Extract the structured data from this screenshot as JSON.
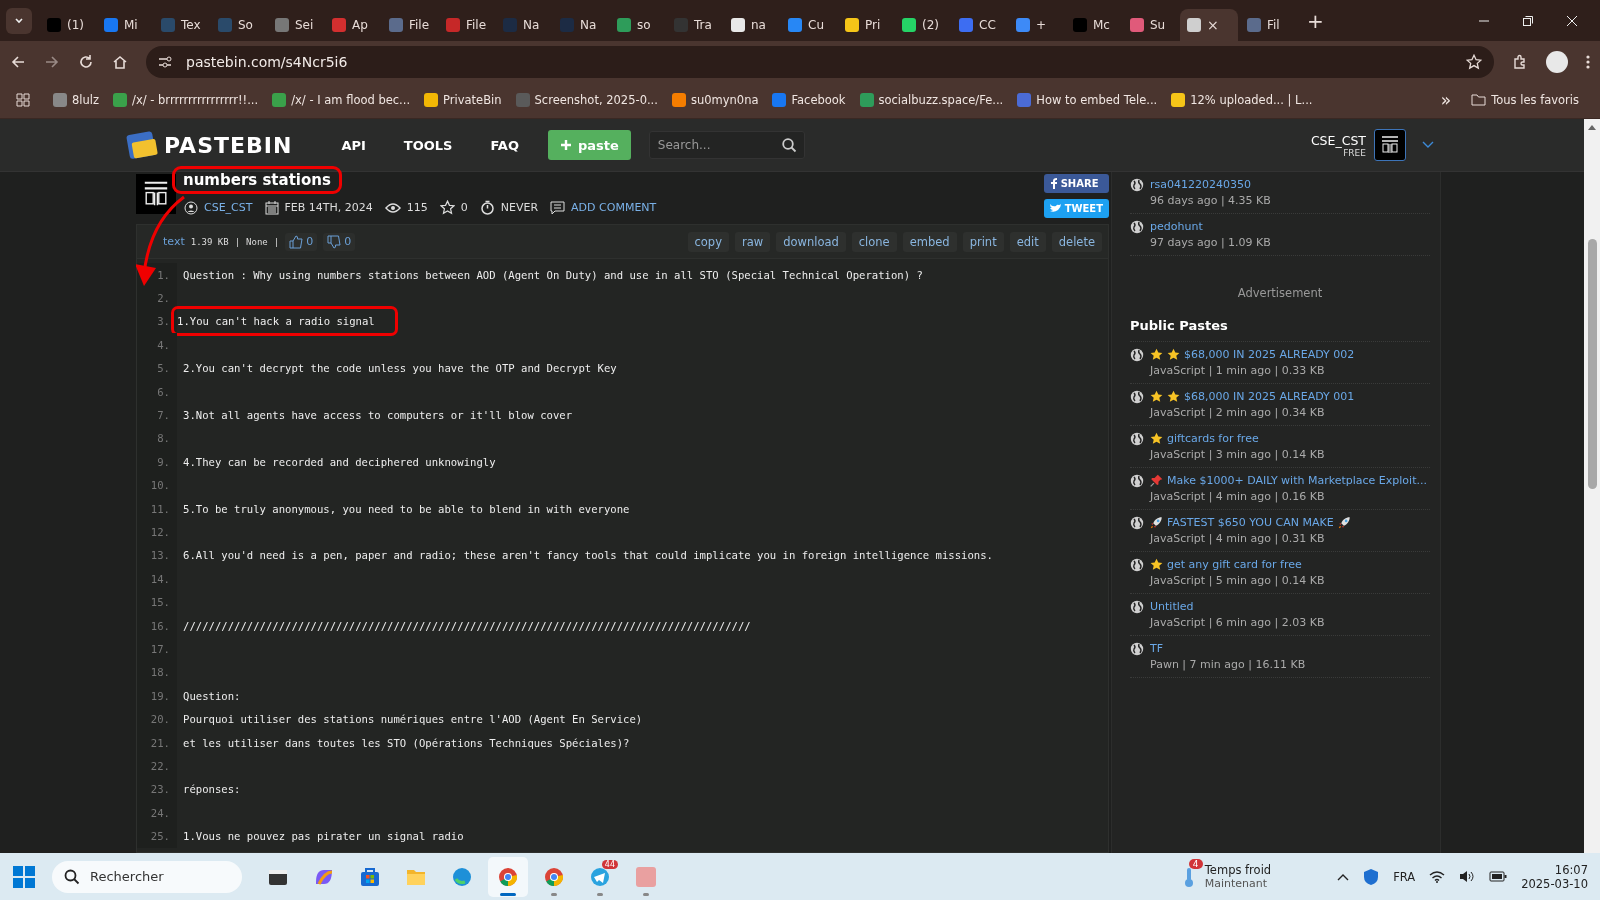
{
  "browser": {
    "tabs": [
      {
        "label": "(1)",
        "color": "#000000",
        "selected": false
      },
      {
        "label": "Mi",
        "color": "#1877f2",
        "selected": false
      },
      {
        "label": "Tex",
        "color": "#2a4a6a",
        "selected": false
      },
      {
        "label": "So",
        "color": "#2a4a6a",
        "selected": false
      },
      {
        "label": "Sei",
        "color": "#777777",
        "selected": false
      },
      {
        "label": "Ap",
        "color": "#d32f2f",
        "selected": false
      },
      {
        "label": "File",
        "color": "#5b6b8c",
        "selected": false
      },
      {
        "label": "File",
        "color": "#c62828",
        "selected": false
      },
      {
        "label": "Na",
        "color": "#1c2b44",
        "selected": false
      },
      {
        "label": "Na",
        "color": "#1c2b44",
        "selected": false
      },
      {
        "label": "so",
        "color": "#2e9c5a",
        "selected": false
      },
      {
        "label": "Tra",
        "color": "#333333",
        "selected": false
      },
      {
        "label": "na",
        "color": "#e8e8e8",
        "selected": false
      },
      {
        "label": "Cu",
        "color": "#2787f5",
        "selected": false
      },
      {
        "label": "Pri",
        "color": "#f5c518",
        "selected": false
      },
      {
        "label": "(2)",
        "color": "#25d366",
        "selected": false
      },
      {
        "label": "CC",
        "color": "#3d6df2",
        "selected": false
      },
      {
        "label": "+ ",
        "color": "#3d8af7",
        "selected": false
      },
      {
        "label": "Mc",
        "color": "#000000",
        "selected": false
      },
      {
        "label": "Su",
        "color": "#e05a7a",
        "selected": false
      },
      {
        "color": "#cfcfcf",
        "selected": true,
        "close": "×"
      },
      {
        "label": "Fil",
        "color": "#5b6b8c",
        "selected": false
      }
    ],
    "new_tab": "+",
    "address": "pastebin.com/s4Ncr5i6",
    "bookmarks": [
      {
        "label": "8lulz",
        "color": "#888888"
      },
      {
        "label": "/x/ - brrrrrrrrrrrrrrrr!!...",
        "color": "#3aa14a"
      },
      {
        "label": "/x/ - I am flood bec...",
        "color": "#3aa14a"
      },
      {
        "label": "PrivateBin",
        "color": "#f2b705"
      },
      {
        "label": "Screenshot, 2025-0...",
        "color": "#5a5a5a"
      },
      {
        "label": "su0myn0na",
        "color": "#f57d00"
      },
      {
        "label": "Facebook",
        "color": "#1877f2"
      },
      {
        "label": "socialbuzz.space/Fe...",
        "color": "#2e9c5a"
      },
      {
        "label": "How to embed Tele...",
        "color": "#4b6bd6"
      },
      {
        "label": "12% uploaded... | L...",
        "color": "#f5c518"
      }
    ],
    "more_bookmarks": "»",
    "all_bookmarks": "Tous les favoris"
  },
  "header": {
    "logo": "PASTEBIN",
    "nav": [
      "API",
      "TOOLS",
      "FAQ"
    ],
    "new_paste": "paste",
    "search": {
      "placeholder": "Search..."
    },
    "user": "CSE_CST",
    "plan": "FREE"
  },
  "paste": {
    "title": "numbers stations",
    "title_highlighted": true,
    "author": "CSE_CST",
    "date": "FEB 14TH, 2024",
    "views": "115",
    "stars": "0",
    "expires": "NEVER",
    "add_comment": "ADD COMMENT",
    "share": "SHARE",
    "tweet": "TWEET",
    "syntax": "text",
    "size": "1.39 KB",
    "sep1": "|",
    "category": "None",
    "sep2": "|",
    "likes": "0",
    "dislikes": "0",
    "actions": [
      "copy",
      "raw",
      "download",
      "clone",
      "embed",
      "print",
      "edit",
      "delete"
    ],
    "annotation_arrow": true,
    "lines": [
      {
        "number": "1.",
        "text": "Question : Why using numbers stations between AOD (Agent On Duty) and use in all STO (Special Technical Operation) ?"
      },
      {
        "number": "2."
      },
      {
        "number": "3.",
        "text": "1.You can't hack a radio signal",
        "highlighted": true
      },
      {
        "number": "4."
      },
      {
        "number": "5.",
        "text": "2.You can't decrypt the code unless you have the OTP and Decrypt Key"
      },
      {
        "number": "6."
      },
      {
        "number": "7.",
        "text": "3.Not all agents have access to computers or it'll blow cover"
      },
      {
        "number": "8."
      },
      {
        "number": "9.",
        "text": "4.They can be recorded and deciphered unknowingly"
      },
      {
        "number": "10."
      },
      {
        "number": "11.",
        "text": "5.To be truly anonymous, you need to be able to blend in with everyone"
      },
      {
        "number": "12."
      },
      {
        "number": "13.",
        "text": "6.All you'd need is a pen, paper and radio; these aren't fancy tools that could implicate you in foreign intelligence missions."
      },
      {
        "number": "14."
      },
      {
        "number": "15."
      },
      {
        "number": "16.",
        "text": "/////////////////////////////////////////////////////////////////////////////////////////"
      },
      {
        "number": "17."
      },
      {
        "number": "18."
      },
      {
        "number": "19.",
        "text": "Question:"
      },
      {
        "number": "20.",
        "text": "Pourquoi utiliser des stations numériques entre l'AOD (Agent En Service)"
      },
      {
        "number": "21.",
        "text": "et les utiliser dans toutes les STO (Opérations Techniques Spéciales)?"
      },
      {
        "number": "22."
      },
      {
        "number": "23.",
        "text": "réponses:"
      },
      {
        "number": "24."
      },
      {
        "number": "25.",
        "text": "1.Vous ne pouvez pas pirater un signal radio"
      }
    ]
  },
  "sidebar": {
    "my_pastes": [
      {
        "title": "rsa041220240350",
        "meta": "96 days ago | 4.35 KB"
      },
      {
        "title": "pedohunt",
        "meta": "97 days ago | 1.09 KB"
      }
    ],
    "advertisement": "Advertisement",
    "public_heading": "Public Pastes",
    "public_pastes": [
      {
        "icons_before": [
          {
            "kind": "star"
          },
          {
            "kind": "star"
          }
        ],
        "title": "$68,000 IN 2025 ALREADY 002",
        "meta": "JavaScript | 1 min ago | 0.33 KB"
      },
      {
        "icons_before": [
          {
            "kind": "star"
          },
          {
            "kind": "star"
          }
        ],
        "title": "$68,000 IN 2025 ALREADY 001",
        "meta": "JavaScript | 2 min ago | 0.34 KB"
      },
      {
        "icons_before": [
          {
            "kind": "star"
          }
        ],
        "title": "giftcards for free",
        "meta": "JavaScript | 3 min ago | 0.14 KB"
      },
      {
        "icons_before": [
          {
            "kind": "pin"
          }
        ],
        "title": "Make $1000+ DAILY with Marketplace Exploit...",
        "meta": "JavaScript | 4 min ago | 0.16 KB"
      },
      {
        "icons_before": [
          {
            "kind": "rocket"
          }
        ],
        "title": "FASTEST $650 YOU CAN MAKE",
        "icons_after": [
          {
            "kind": "rocket"
          }
        ],
        "meta": "JavaScript | 4 min ago | 0.31 KB"
      },
      {
        "icons_before": [
          {
            "kind": "star"
          }
        ],
        "title": "get any gift card for free",
        "meta": "JavaScript | 5 min ago | 0.14 KB"
      },
      {
        "title": "Untitled",
        "meta": "JavaScript | 6 min ago | 2.03 KB"
      },
      {
        "title": "TF",
        "meta": "Pawn | 7 min ago | 16.11 KB"
      }
    ]
  },
  "taskbar": {
    "search": "Rechercher",
    "apps": [
      {
        "kind": "files-dark"
      },
      {
        "kind": "copilot"
      },
      {
        "kind": "store"
      },
      {
        "kind": "folder"
      },
      {
        "kind": "edge"
      },
      {
        "kind": "chrome",
        "selected": true
      },
      {
        "kind": "chrome",
        "selected": false
      },
      {
        "kind": "telegram",
        "badge": "44",
        "selected": false
      },
      {
        "kind": "app",
        "selected": false
      }
    ],
    "weather_badge": "4",
    "weather_title": "Temps froid",
    "weather_sub": "Maintenant",
    "language": "FRA",
    "time": "16:07",
    "date": "2025-03-10"
  }
}
